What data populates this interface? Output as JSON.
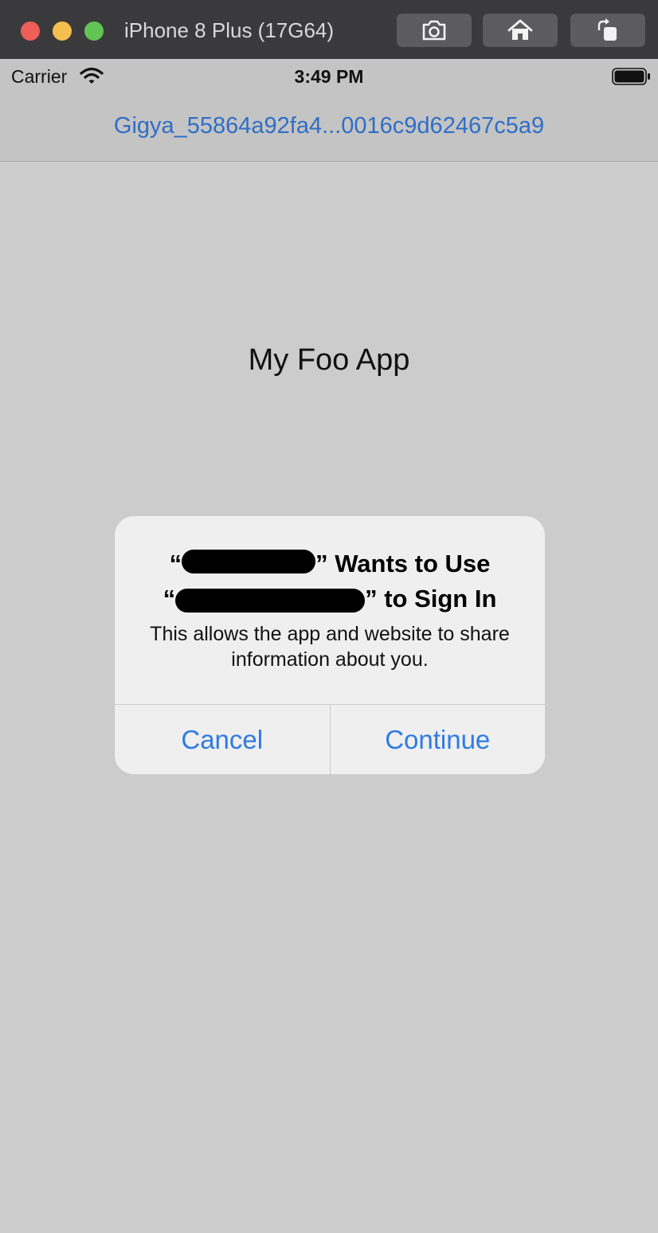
{
  "simulator": {
    "device_title": "iPhone 8 Plus (17G64)"
  },
  "status_bar": {
    "carrier": "Carrier",
    "time": "3:49 PM"
  },
  "nav_bar": {
    "title": "Gigya_55864a92fa4...0016c9d62467c5a9"
  },
  "main": {
    "heading": "My Foo App"
  },
  "alert": {
    "title_line1_open_quote": "“",
    "title_line1_suffix": "” Wants to Use",
    "title_line2_open_quote": "“",
    "title_line2_suffix": "” to Sign In",
    "message": "This allows the app and website to share information about you.",
    "cancel_label": "Cancel",
    "continue_label": "Continue"
  },
  "colors": {
    "accent": "#2f7be2",
    "nav_title": "#2f6ec6",
    "background": "#cccccc"
  }
}
